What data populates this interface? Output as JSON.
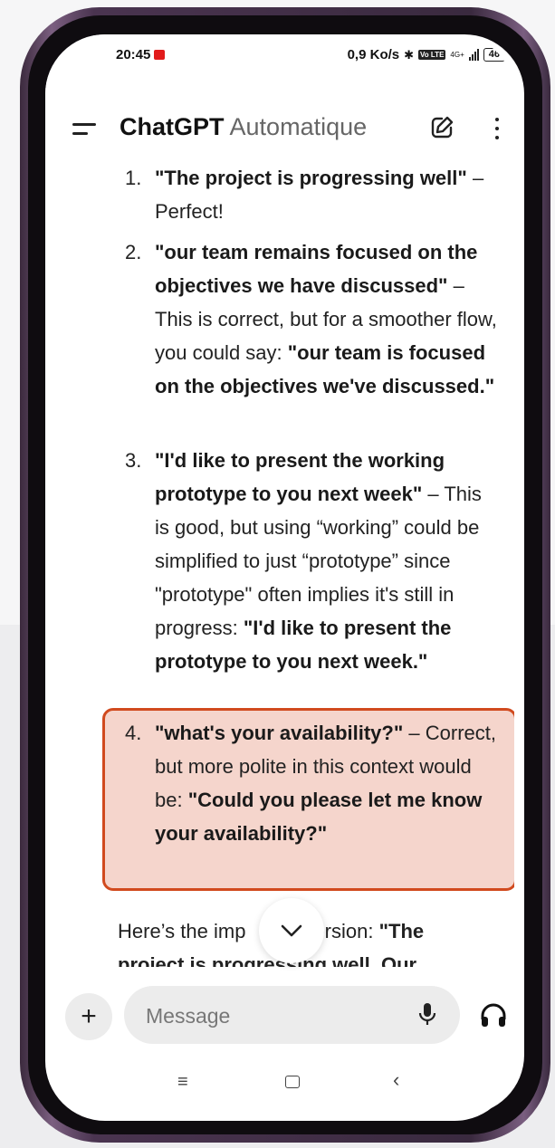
{
  "status_bar": {
    "time": "20:45",
    "net_speed": "0,9 Ko/s",
    "network_type": "4G+",
    "battery": "46",
    "volte_badge": "Vo LTE"
  },
  "header": {
    "app_name": "ChatGPT",
    "model_mode": "Automatique"
  },
  "corrections": [
    {
      "number": "1.",
      "quote": "\"The project is progressing well\"",
      "comment": " – Perfect!"
    },
    {
      "number": "2.",
      "quote": "\"our team remains focused on the objectives we have discussed\"",
      "comment": " – This is correct, but for a smoother flow, you could say: ",
      "suggestion": "\"our team is focused on the objectives we've discussed.\""
    },
    {
      "number": "3.",
      "quote": "\"I'd like to present the working prototype to you next week\"",
      "comment": " – This is good, but using “working” could be simplified to just “prototype” since \"prototype\" often implies it's still in progress: ",
      "suggestion": "\"I'd like to present the prototype to you next week.\""
    },
    {
      "number": "4.",
      "quote": "\"what's your availability?\"",
      "comment": " – Correct, but more polite in this context would be: ",
      "suggestion": "\"Could you please let me know your availability?\""
    }
  ],
  "improved": {
    "prefix": "Here’s the imp",
    "middle": "version: ",
    "bold_start": "\"The",
    "line2": "project is progressing well. Our"
  },
  "composer": {
    "placeholder": "Message",
    "value": ""
  },
  "colors": {
    "highlight_fill": "#f5d5cc",
    "highlight_border": "#d14a1e",
    "phone_frame": "#5a4260"
  }
}
